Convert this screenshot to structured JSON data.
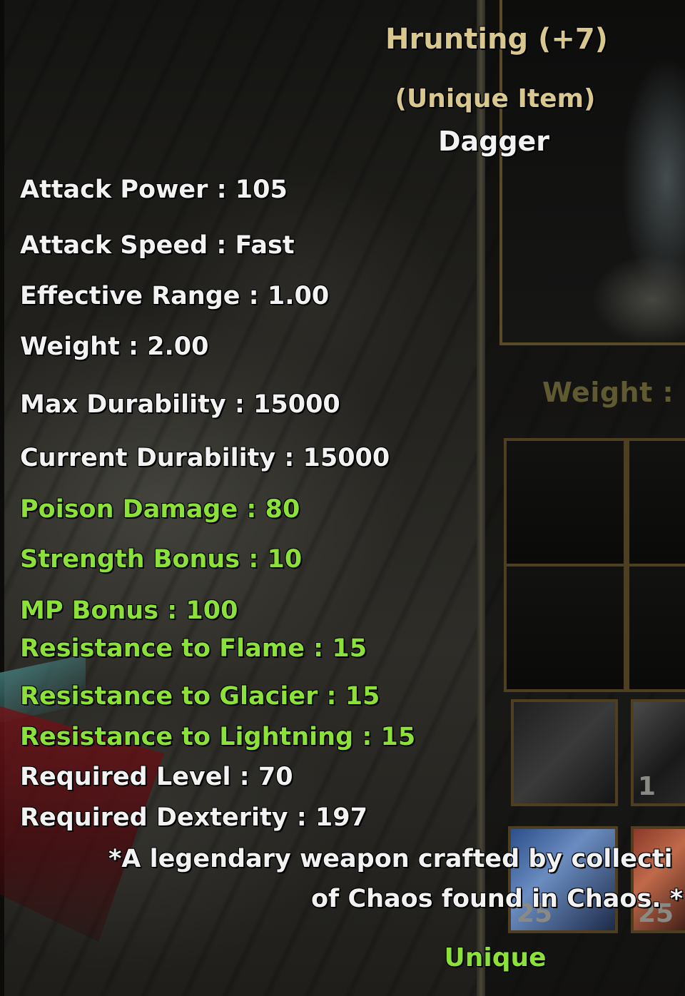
{
  "item": {
    "name": "Hrunting (+7)",
    "type_note": "(Unique Item)",
    "kind": "Dagger",
    "base_stats": [
      "Attack Power : 105",
      "Attack Speed : Fast",
      "Effective Range : 1.00",
      "Weight : 2.00",
      "Max Durability : 15000",
      "Current Durability : 15000"
    ],
    "bonus_stats": [
      "Poison Damage : 80",
      "Strength Bonus : 10",
      "MP Bonus : 100",
      "Resistance to Flame : 15",
      "Resistance to Glacier : 15",
      "Resistance to Lightning : 15"
    ],
    "requirements": [
      "Required Level : 70",
      "Required Dexterity : 197"
    ],
    "description_line1": "*A legendary weapon crafted by collecti",
    "description_line2": "of Chaos found in Chaos. *",
    "rarity": "Unique"
  },
  "inventory_panel": {
    "weight_label": "Weight :",
    "slot_counts": [
      "1",
      "25",
      "25"
    ]
  },
  "colors": {
    "bonus_text": "#8be03a",
    "base_text": "#f2f2f2",
    "title_text": "#d8c890",
    "panel_border": "#4f3f22"
  }
}
